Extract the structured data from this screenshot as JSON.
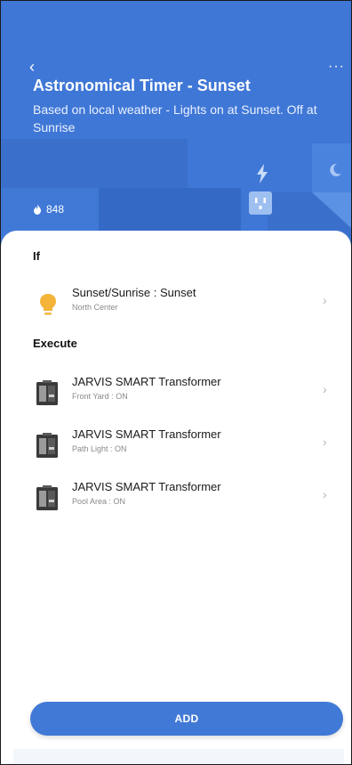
{
  "header": {
    "back_label": "‹",
    "more_label": "···",
    "title": "Astronomical Timer - Sunset",
    "subtitle": "Based on local weather - Lights on at Sunset. Off at Sunrise",
    "likes": "848",
    "bg_color": "#3f77d6"
  },
  "condition": {
    "section_label": "If",
    "items": [
      {
        "title": "Sunset/Sunrise : Sunset",
        "subtitle": "North Center",
        "icon": "lightbulb-icon"
      }
    ]
  },
  "execute": {
    "section_label": "Execute",
    "items": [
      {
        "title": "JARVIS SMART Transformer",
        "subtitle": "Front Yard : ON",
        "icon": "transformer-icon"
      },
      {
        "title": "JARVIS SMART Transformer",
        "subtitle": "Path Light : ON",
        "icon": "transformer-icon"
      },
      {
        "title": "JARVIS SMART Transformer",
        "subtitle": "Pool Area : ON",
        "icon": "transformer-icon"
      }
    ]
  },
  "add_button": {
    "label": "ADD",
    "color": "#4179d6"
  }
}
